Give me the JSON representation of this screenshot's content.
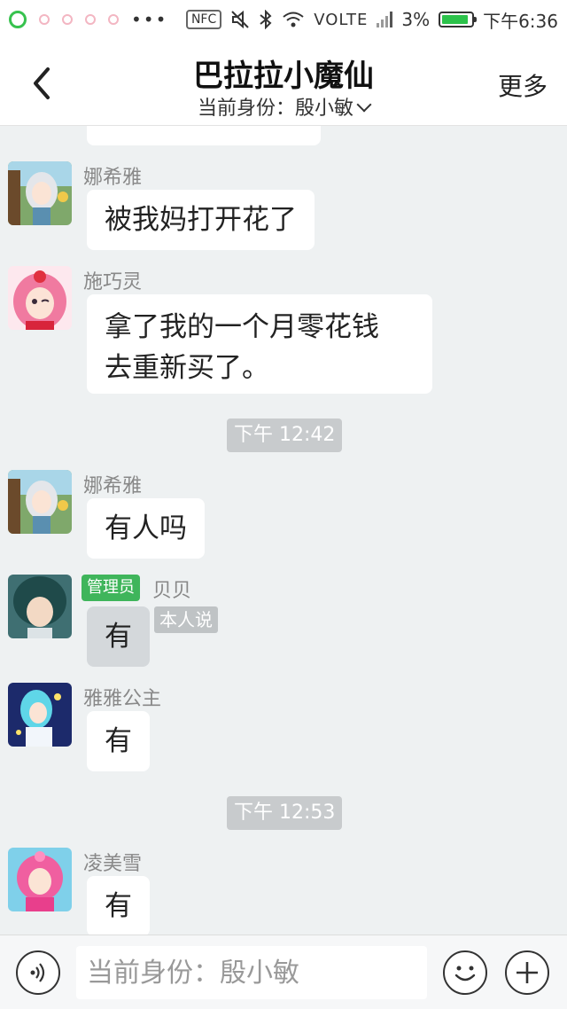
{
  "status_bar": {
    "nfc": "NFC",
    "network": "VOLTE",
    "battery_percent": "3%",
    "battery_level": 0.03,
    "time": "下午6:36"
  },
  "header": {
    "title": "巴拉拉小魔仙",
    "identity": "当前身份：殷小敏",
    "more": "更多"
  },
  "messages": [
    {
      "sender": "娜希雅",
      "text": "被我妈打开花了"
    },
    {
      "sender": "施巧灵",
      "text_lines": [
        "拿了我的一个月零花钱",
        "去重新买了。"
      ]
    },
    {
      "time": "下午 12:42"
    },
    {
      "sender": "娜希雅",
      "text": "有人吗"
    },
    {
      "admin_badge": "管理员",
      "sender": "贝贝",
      "self_tag": "本人说",
      "text": "有"
    },
    {
      "sender": "雅雅公主",
      "text": "有"
    },
    {
      "time": "下午 12:53"
    },
    {
      "sender": "凌美雪",
      "text": "有"
    }
  ],
  "input": {
    "placeholder": "当前身份：殷小敏"
  },
  "colors": {
    "accent_green": "#3fb55b",
    "background": "#eef1f2",
    "bubble": "#ffffff"
  }
}
